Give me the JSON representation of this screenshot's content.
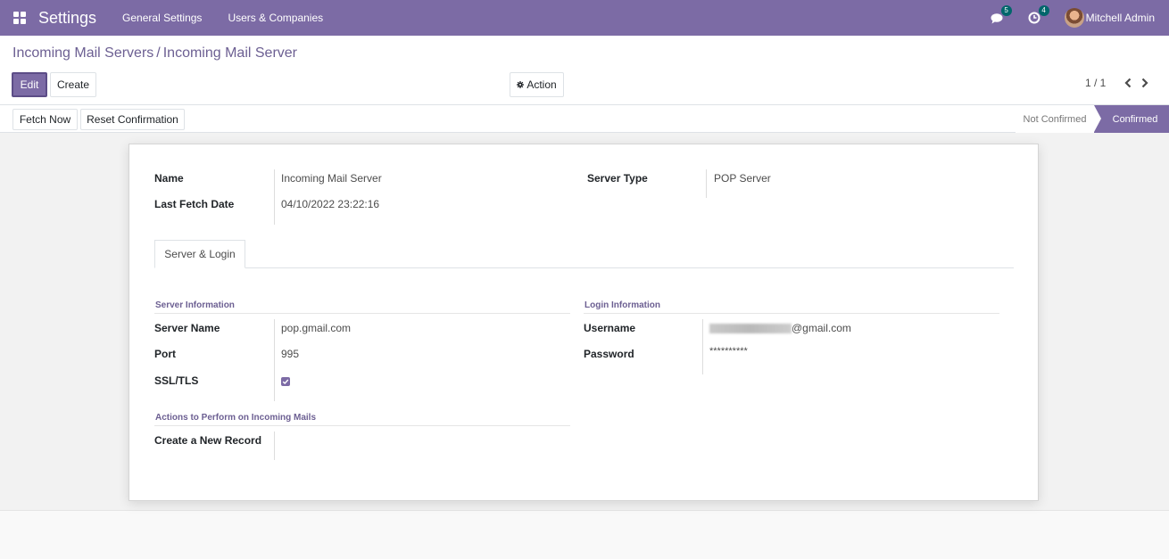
{
  "navbar": {
    "app_title": "Settings",
    "menu": [
      "General Settings",
      "Users & Companies"
    ],
    "messages_badge": "5",
    "activities_badge": "4",
    "user_name": "Mitchell Admin",
    "brand_color": "#7c6ba5"
  },
  "breadcrumb": {
    "parent": "Incoming Mail Servers",
    "separator": "/",
    "current": "Incoming Mail Server"
  },
  "buttons": {
    "edit": "Edit",
    "create": "Create",
    "action": "Action",
    "action_icon": "gear-icon",
    "fetch_now": "Fetch Now",
    "reset_confirmation": "Reset Confirmation"
  },
  "pager": {
    "value": "1 / 1"
  },
  "statusbar": {
    "steps": [
      "Not Confirmed",
      "Confirmed"
    ],
    "active": "Confirmed"
  },
  "form": {
    "name_label": "Name",
    "name_value": "Incoming Mail Server",
    "last_fetch_label": "Last Fetch Date",
    "last_fetch_value": "04/10/2022 23:22:16",
    "server_type_label": "Server Type",
    "server_type_value": "POP Server",
    "tab_label": "Server & Login",
    "server_info_title": "Server Information",
    "server_name_label": "Server Name",
    "server_name_value": "pop.gmail.com",
    "port_label": "Port",
    "port_value": "995",
    "ssl_label": "SSL/TLS",
    "ssl_checked": true,
    "login_info_title": "Login Information",
    "username_label": "Username",
    "username_suffix": "@gmail.com",
    "password_label": "Password",
    "password_value": "**********",
    "actions_title": "Actions to Perform on Incoming Mails",
    "create_record_label": "Create a New Record",
    "create_record_value": ""
  }
}
